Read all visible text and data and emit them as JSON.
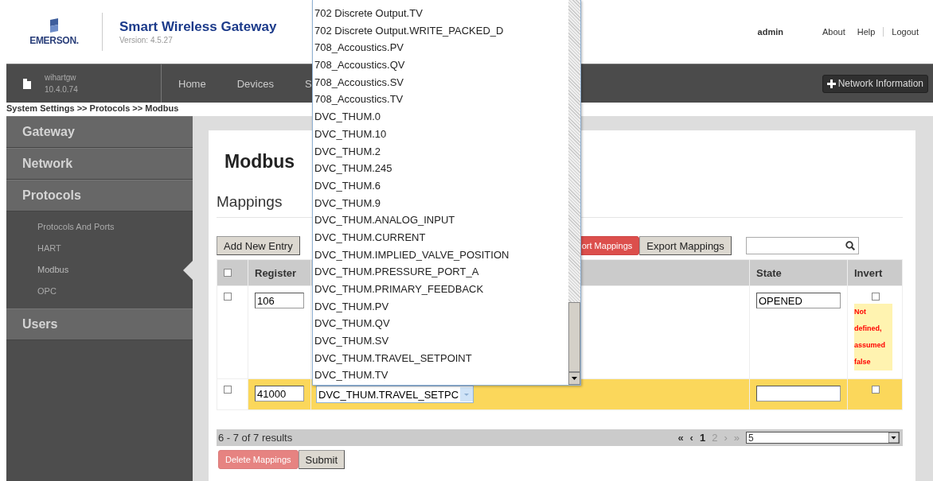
{
  "header": {
    "brand": "EMERSON.",
    "title": "Smart Wireless Gateway",
    "version": "Version: 4.5.27",
    "user": "admin",
    "links": [
      "About",
      "Help",
      "Logout"
    ]
  },
  "navbar": {
    "host": "wihartgw",
    "ip": "10.4.0.74",
    "items": [
      "Home",
      "Devices",
      "S"
    ],
    "network_button": "Network Information"
  },
  "breadcrumb": "System Settings >> Protocols >> Modbus",
  "sidebar": {
    "items": [
      {
        "label": "Gateway"
      },
      {
        "label": "Network"
      },
      {
        "label": "Protocols",
        "children": [
          {
            "label": "Protocols And Ports",
            "selected": false
          },
          {
            "label": "HART",
            "selected": false
          },
          {
            "label": "Modbus",
            "selected": true
          },
          {
            "label": "OPC",
            "selected": false
          }
        ]
      },
      {
        "label": "Users"
      }
    ]
  },
  "page": {
    "title": "Modbus",
    "section": "Mappings",
    "toolbar": [
      {
        "kind": "plain",
        "label": "Add New Entry"
      },
      {
        "kind": "danger",
        "label": "ort Mappings"
      },
      {
        "kind": "plain",
        "label": "Export Mappings"
      }
    ],
    "table": {
      "select_all": {
        "checked": false
      },
      "columns": [
        "Register",
        null,
        "State",
        "Invert"
      ],
      "rows": [
        {
          "checked": false,
          "highlighted": false,
          "register": "106",
          "state": "OPENED",
          "invert": false,
          "warning": "Not defined, assumed false"
        },
        {
          "checked": false,
          "highlighted": true,
          "register": "41000",
          "point": "DVC_THUM.TRAVEL_SETPC",
          "invert": false
        }
      ]
    },
    "pager": {
      "summary": "6 - 7 of 7 results",
      "pages": [
        {
          "label": "«",
          "selected": false,
          "disabled": false
        },
        {
          "label": "‹",
          "selected": false,
          "disabled": false
        },
        {
          "label": "1",
          "selected": true,
          "disabled": false
        },
        {
          "label": "2",
          "selected": false,
          "disabled": true
        },
        {
          "label": "›",
          "selected": false,
          "disabled": true
        },
        {
          "label": "»",
          "selected": false,
          "disabled": true
        }
      ],
      "page_size": "5"
    },
    "actions": [
      {
        "kind": "danger",
        "label": "Delete Mappings",
        "disabled": true
      },
      {
        "kind": "plain",
        "label": "Submit",
        "disabled": false
      }
    ]
  },
  "dropdown": {
    "options": [
      {
        "label": "702 Discrete Output.TV",
        "selected": false
      },
      {
        "label": "702 Discrete Output.WRITE_PACKED_D",
        "selected": false
      },
      {
        "label": "708_Accoustics.PV",
        "selected": false
      },
      {
        "label": "708_Accoustics.QV",
        "selected": false
      },
      {
        "label": "708_Accoustics.SV",
        "selected": false
      },
      {
        "label": "708_Accoustics.TV",
        "selected": false
      },
      {
        "label": "DVC_THUM.0",
        "selected": false
      },
      {
        "label": "DVC_THUM.10",
        "selected": false
      },
      {
        "label": "DVC_THUM.2",
        "selected": false
      },
      {
        "label": "DVC_THUM.245",
        "selected": false
      },
      {
        "label": "DVC_THUM.6",
        "selected": false
      },
      {
        "label": "DVC_THUM.9",
        "selected": false
      },
      {
        "label": "DVC_THUM.ANALOG_INPUT",
        "selected": false
      },
      {
        "label": "DVC_THUM.CURRENT",
        "selected": false
      },
      {
        "label": "DVC_THUM.IMPLIED_VALVE_POSITION",
        "selected": false
      },
      {
        "label": "DVC_THUM.PRESSURE_PORT_A",
        "selected": false
      },
      {
        "label": "DVC_THUM.PRIMARY_FEEDBACK",
        "selected": false
      },
      {
        "label": "DVC_THUM.PV",
        "selected": false
      },
      {
        "label": "DVC_THUM.QV",
        "selected": false
      },
      {
        "label": "DVC_THUM.SV",
        "selected": false
      },
      {
        "label": "DVC_THUM.TRAVEL_SETPOINT",
        "selected": false
      },
      {
        "label": "DVC_THUM.TV",
        "selected": false
      }
    ]
  }
}
